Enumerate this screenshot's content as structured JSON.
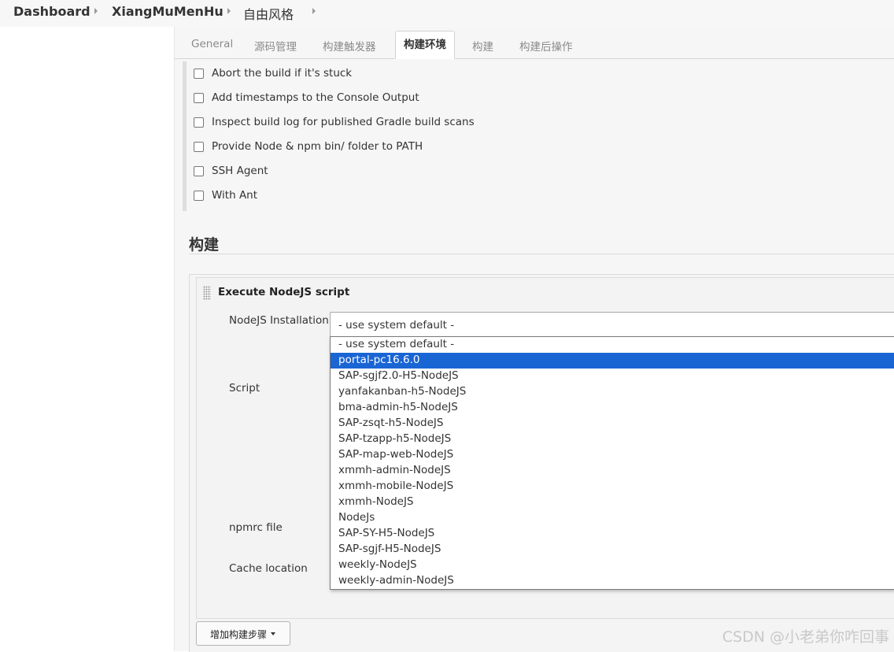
{
  "breadcrumb": {
    "items": [
      "Dashboard",
      "XiangMuMenHu",
      "自由风格"
    ]
  },
  "tabs": [
    {
      "label": "General",
      "active": false
    },
    {
      "label": "源码管理",
      "active": false
    },
    {
      "label": "构建触发器",
      "active": false
    },
    {
      "label": "构建环境",
      "active": true
    },
    {
      "label": "构建",
      "active": false
    },
    {
      "label": "构建后操作",
      "active": false
    }
  ],
  "build_env": {
    "options": [
      {
        "label": "Abort the build if it's stuck",
        "checked": false
      },
      {
        "label": "Add timestamps to the Console Output",
        "checked": false
      },
      {
        "label": "Inspect build log for published Gradle build scans",
        "checked": false
      },
      {
        "label": "Provide Node & npm bin/ folder to PATH",
        "checked": false
      },
      {
        "label": "SSH Agent",
        "checked": false
      },
      {
        "label": "With Ant",
        "checked": false
      }
    ]
  },
  "build_section": {
    "heading": "构建",
    "step": {
      "title": "Execute NodeJS script",
      "fields": {
        "nodejs_installation": "NodeJS Installation",
        "script": "Script",
        "npmrc": "npmrc file",
        "cache": "Cache location"
      },
      "select": {
        "value": "- use system default -",
        "highlighted": "portal-pc16.6.0",
        "options": [
          "- use system default -",
          "portal-pc16.6.0",
          "SAP-sgjf2.0-H5-NodeJS",
          "yanfakanban-h5-NodeJS",
          "bma-admin-h5-NodeJS",
          "SAP-zsqt-h5-NodeJS",
          "SAP-tzapp-h5-NodeJS",
          "SAP-map-web-NodeJS",
          "xmmh-admin-NodeJS",
          "xmmh-mobile-NodeJS",
          "xmmh-NodeJS",
          "NodeJs",
          "SAP-SY-H5-NodeJS",
          "SAP-sgjf-H5-NodeJS",
          "weekly-NodeJS",
          "weekly-admin-NodeJS"
        ]
      }
    },
    "add_step_label": "增加构建步骤"
  },
  "watermark": "CSDN @小老弟你咋回事",
  "colors": {
    "accent_selected": "#1a65d4",
    "topbar_bg": "#f7f7f8",
    "panel_bg": "#f6f6f6"
  }
}
